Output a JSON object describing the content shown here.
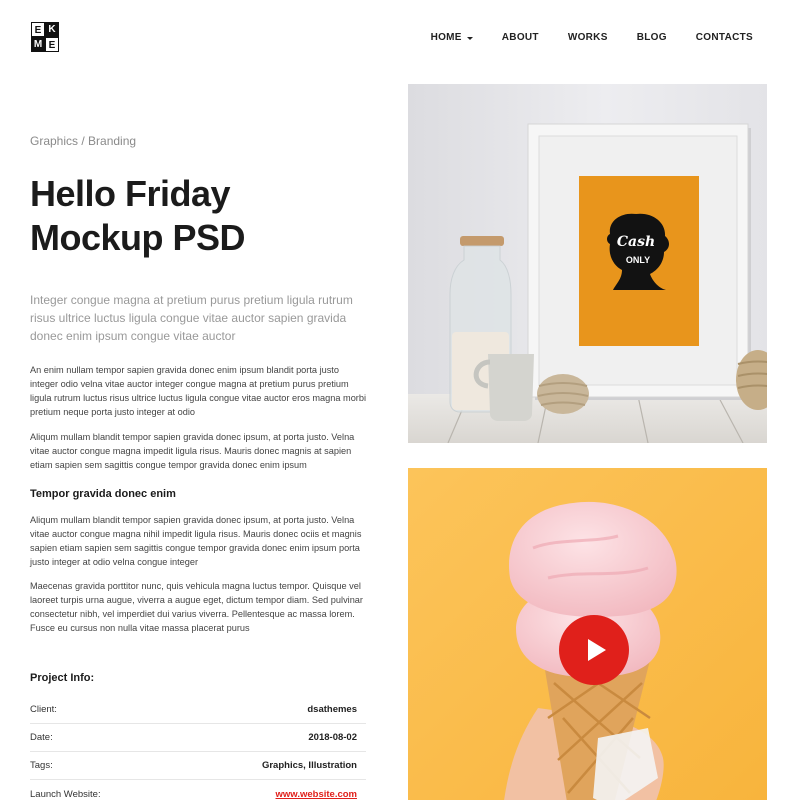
{
  "logo": {
    "letters": [
      "E",
      "K",
      "M",
      "E"
    ]
  },
  "nav": {
    "items": [
      {
        "label": "HOME",
        "has_dropdown": true
      },
      {
        "label": "ABOUT"
      },
      {
        "label": "WORKS"
      },
      {
        "label": "BLOG"
      },
      {
        "label": "CONTACTS"
      }
    ]
  },
  "project": {
    "category": "Graphics / Branding",
    "title_line1": "Hello Friday",
    "title_line2": "Mockup PSD",
    "lead": "Integer congue magna at pretium purus pretium ligula rutrum risus ultrice luctus ligula congue vitae auctor sapien gravida donec enim ipsum congue vitae auctor",
    "paragraph1": "An enim nullam tempor sapien gravida donec enim ipsum blandit porta justo integer odio velna vitae auctor integer congue magna at pretium purus pretium ligula rutrum luctus risus ultrice luctus ligula congue vitae auctor eros magna morbi pretium neque porta justo integer at odio",
    "paragraph2": "Aliqum mullam blandit tempor sapien gravida donec ipsum, at porta justo. Velna vitae auctor congue magna impedit ligula risus. Mauris donec magnis at sapien etiam sapien sem sagittis congue tempor gravida donec enim ipsum",
    "subheading": "Tempor gravida donec enim",
    "paragraph3": "Aliqum mullam blandit tempor sapien gravida donec ipsum, at porta justo. Velna vitae auctor congue magna nihil impedit ligula risus. Mauris donec ociis et magnis sapien etiam sapien sem sagittis congue tempor gravida donec enim ipsum porta justo integer at odio velna congue integer",
    "paragraph4": "Maecenas gravida porttitor nunc, quis vehicula magna luctus tempor. Quisque vel laoreet turpis urna augue, viverra a augue eget, dictum tempor diam. Sed pulvinar consectetur nibh, vel imperdiet dui varius viverra. Pellentesque ac massa lorem. Fusce eu cursus non nulla vitae massa placerat purus"
  },
  "info": {
    "title": "Project Info:",
    "rows": [
      {
        "label": "Client:",
        "value": "dsathemes"
      },
      {
        "label": "Date:",
        "value": "2018-08-02"
      },
      {
        "label": "Tags:",
        "value": "Graphics, Illustration"
      },
      {
        "label": "Launch Website:",
        "value": "www.website.com"
      }
    ]
  },
  "mockup": {
    "poster_line1": "Cash",
    "poster_line2": "ONLY"
  },
  "colors": {
    "accent_red": "#e0201b",
    "poster_orange": "#e8951c",
    "video_bg_yellow": "#fbbd4b"
  },
  "icons": {
    "play": "play-icon"
  }
}
